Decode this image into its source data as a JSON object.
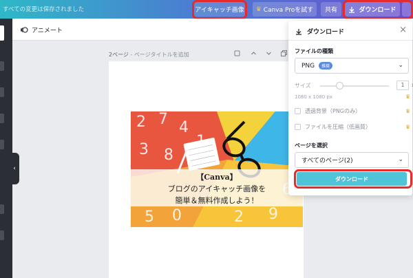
{
  "topbar": {
    "saved_text": "すべての変更は保存されました",
    "eyecatch_label": "アイキャッチ画像",
    "pro_label": "Canva Proを試す",
    "share_label": "共有",
    "download_label": "ダウンロード"
  },
  "subbar": {
    "animate_label": "アニメート"
  },
  "page": {
    "page_label": "2ページ",
    "title_placeholder": " - ページタイトルを追加"
  },
  "eyecatch": {
    "line1": "【Canva】",
    "line2": "ブログのアイキャッチ画像を",
    "line3": "簡単＆無料作成しよう！"
  },
  "panel": {
    "title": "ダウンロード",
    "file_type_label": "ファイルの種類",
    "file_type_value": "PNG",
    "file_type_badge": "推奨",
    "size_label": "サイズ",
    "size_value": "1",
    "size_unit": "x",
    "dimensions": "1080 x 1080 px",
    "transparent_label": "透過背景（PNGのみ）",
    "compress_label": "ファイルを圧縮（低画質）",
    "pages_label": "ページを選択",
    "pages_value": "すべてのページ(2)",
    "download_button": "ダウンロード"
  },
  "colors": {
    "accent": "#4fc3d8",
    "highlight": "#e52b2b",
    "crown": "#e0a82e"
  }
}
